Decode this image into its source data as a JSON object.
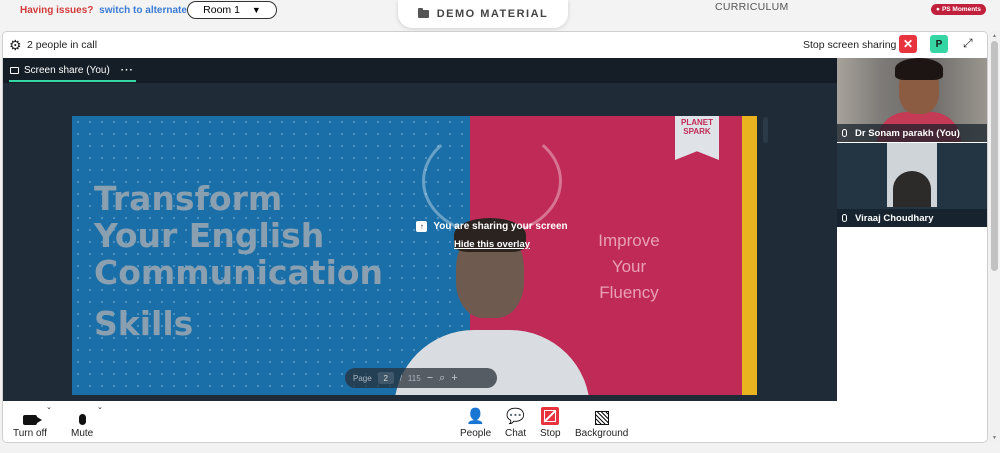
{
  "top": {
    "issue_text": "Having issues?",
    "alt_room_link": "switch to alternate room",
    "room_select": "Room 1",
    "demo_material": "DEMO MATERIAL",
    "curriculum": "CURRICULUM",
    "ps_moments": "PS Moments"
  },
  "call": {
    "people_count": "2 people in call",
    "stop_share_label": "Stop screen sharing",
    "user_badge": "P",
    "share_tab": "Screen share (You)",
    "overlay_text": "You are sharing your screen",
    "overlay_link": "Hide this overlay"
  },
  "slide": {
    "brand_line1": "PLANET",
    "brand_line2": "SPARK",
    "headline_l1": "Transform",
    "headline_l2": "Your English",
    "headline_l3": "Communication",
    "headline_l4": "Skills",
    "sub_l1": "Improve",
    "sub_l2": "Your",
    "sub_l3": "Fluency"
  },
  "pager": {
    "page_label": "Page",
    "current_page": "2",
    "separator": "/",
    "total_pages": "115"
  },
  "participants": [
    {
      "name": "Dr Sonam parakh (You)"
    },
    {
      "name": "Viraaj Choudhary"
    }
  ],
  "controls": {
    "camera": "Turn off",
    "mic": "Mute",
    "people": "People",
    "chat": "Chat",
    "stop": "Stop",
    "background": "Background"
  },
  "colors": {
    "accent_green": "#36d5a4",
    "stop_red": "#e8333e",
    "slide_blue": "#1b6fa8",
    "slide_red": "#c02a57"
  }
}
